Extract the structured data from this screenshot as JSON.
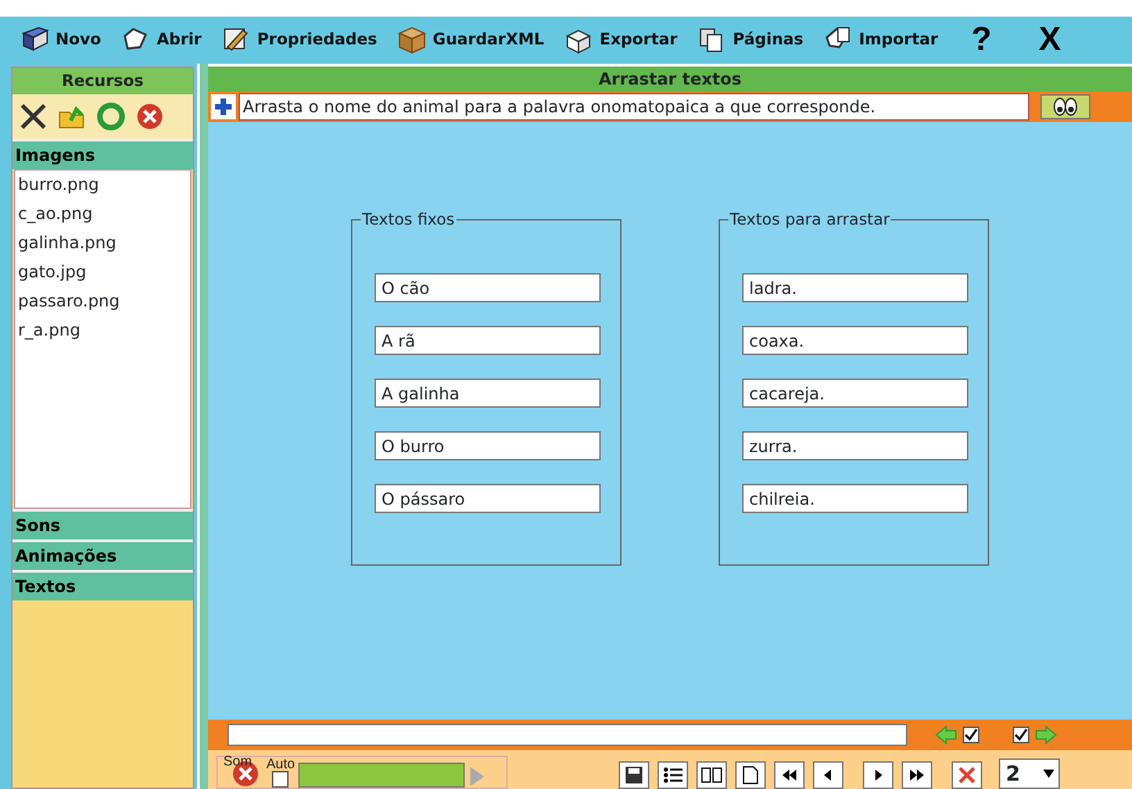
{
  "toolbar": [
    {
      "label": "Novo"
    },
    {
      "label": "Abrir"
    },
    {
      "label": "Propriedades"
    },
    {
      "label": "GuardarXML"
    },
    {
      "label": "Exportar"
    },
    {
      "label": "Páginas"
    },
    {
      "label": "Importar"
    }
  ],
  "toolbar_glyphs": [
    "?",
    "X"
  ],
  "sidebar": {
    "title": "Recursos",
    "sections": [
      {
        "label": "Imagens",
        "items": [
          "burro.png",
          "c_ao.png",
          "galinha.png",
          "gato.jpg",
          "passaro.png",
          "r_a.png"
        ]
      },
      {
        "label": "Sons"
      },
      {
        "label": "Animações"
      },
      {
        "label": "Textos"
      }
    ]
  },
  "main": {
    "title": "Arrastar textos",
    "instruction": "Arrasta o nome do animal para a palavra onomatopaica a que corresponde.",
    "groups": [
      {
        "legend": "Textos fixos",
        "items": [
          "O cão",
          "A rã",
          "A galinha",
          "O burro",
          "O pássaro"
        ]
      },
      {
        "legend": "Textos para arrastar",
        "items": [
          "ladra.",
          "coaxa.",
          "cacareja.",
          "zurra.",
          "chilreia."
        ]
      }
    ]
  },
  "footer": {
    "checks": [
      {
        "checked": true
      },
      {
        "checked": true
      }
    ],
    "sound_label": "Som",
    "auto": {
      "label": "Auto",
      "checked": false
    },
    "page": "2"
  }
}
